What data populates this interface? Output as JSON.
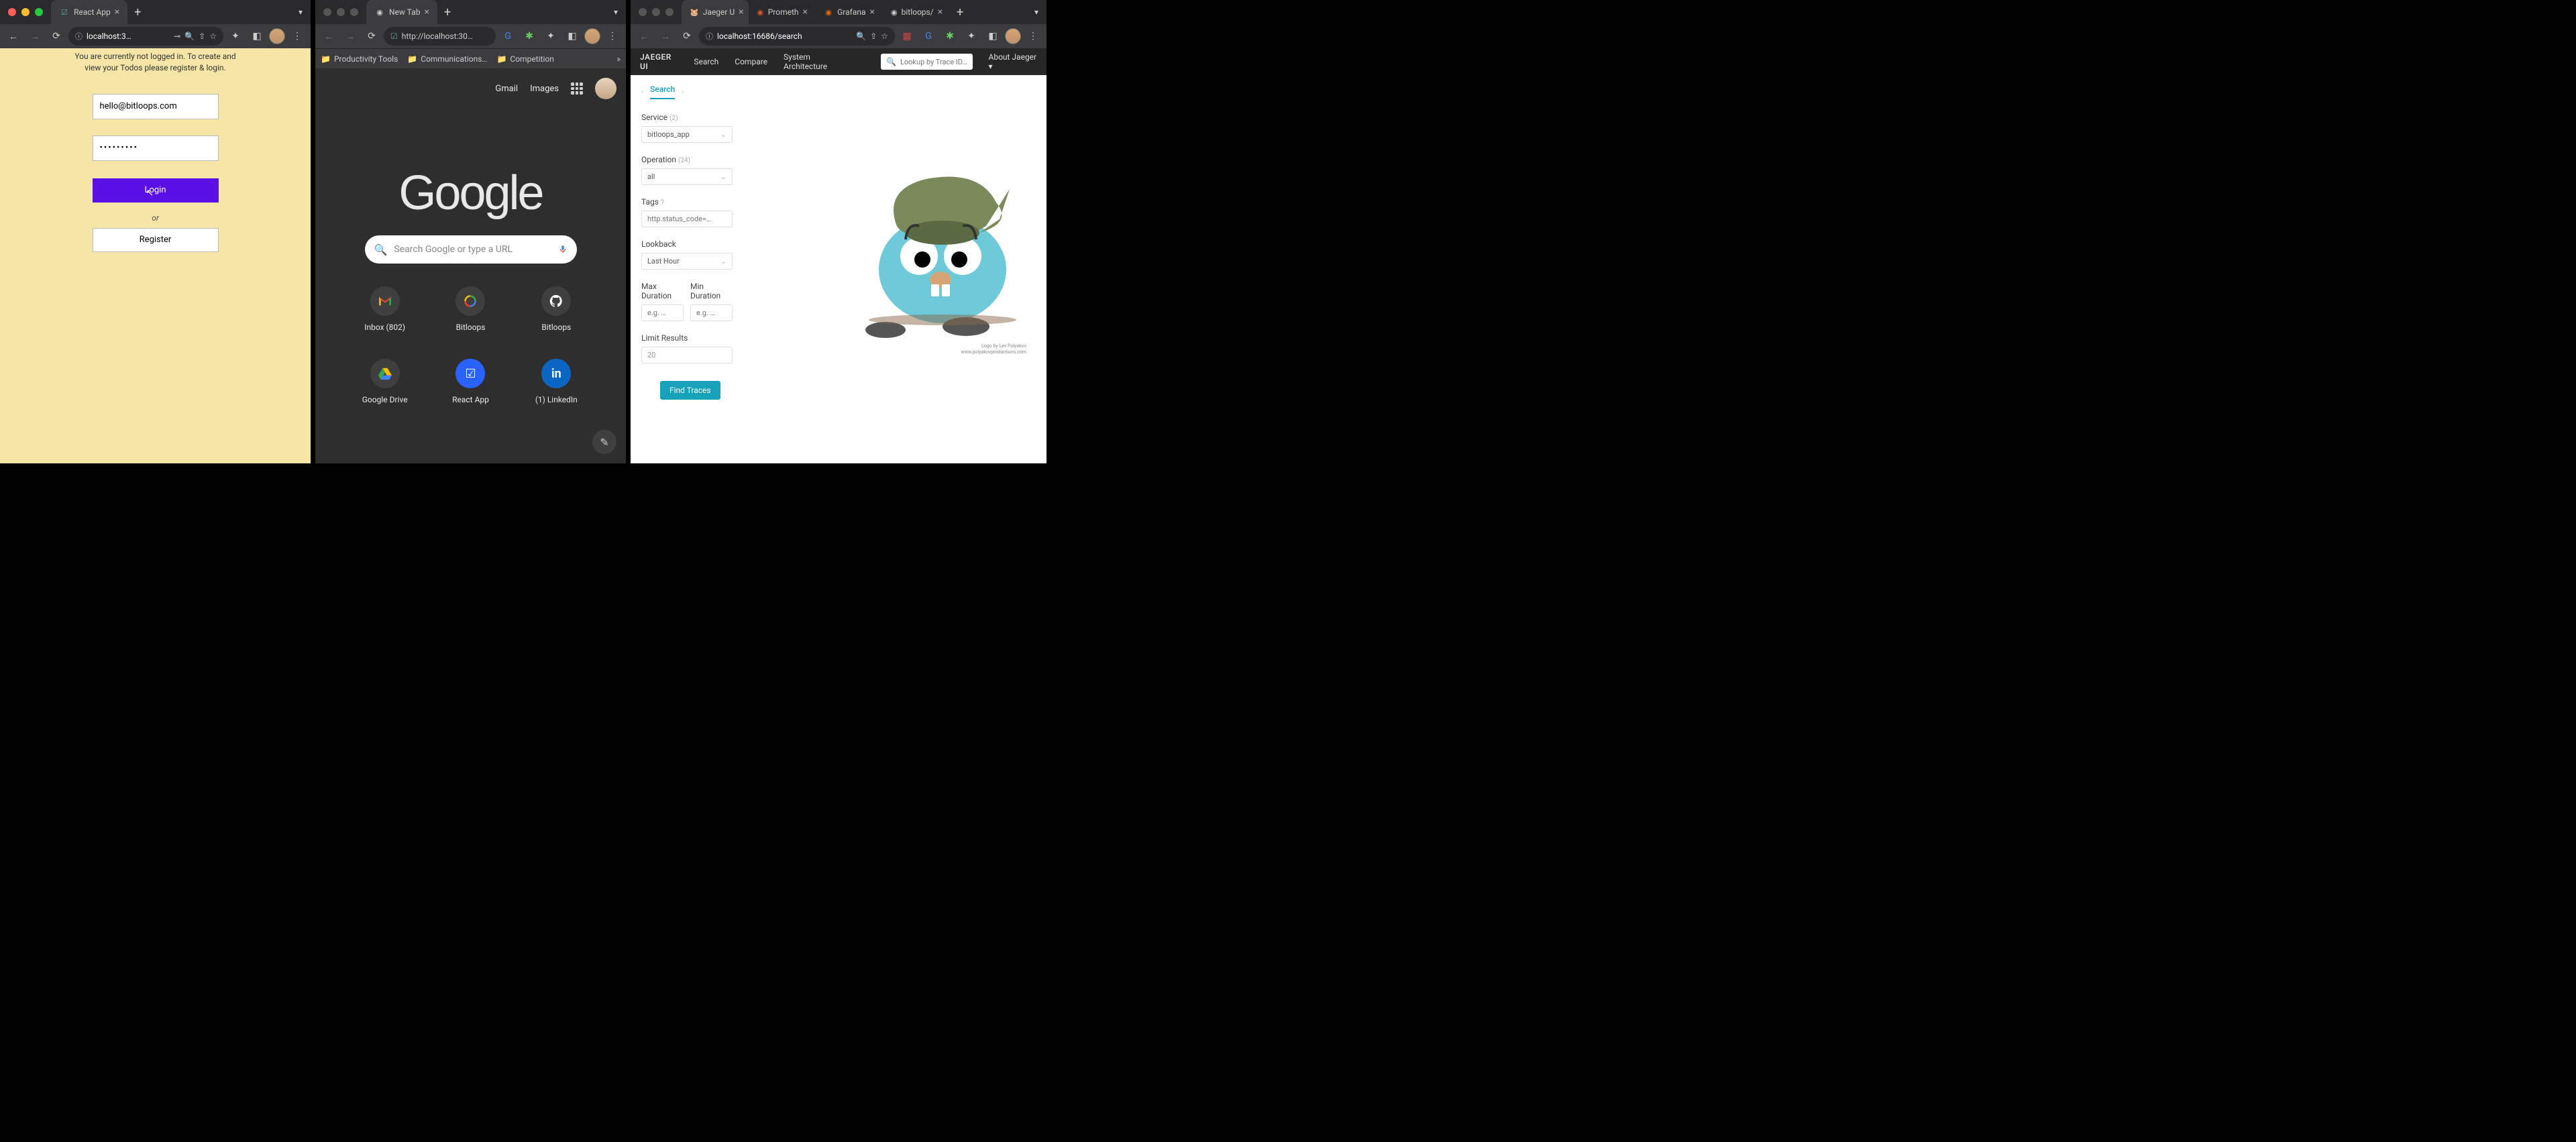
{
  "w1": {
    "tab_title": "React App",
    "url": "localhost:3…",
    "msg": "You are currently not logged in. To create and view your Todos please register & login.",
    "email": "hello@bitloops.com",
    "password": "•••••••••",
    "login_label": "Login",
    "or_label": "or",
    "register_label": "Register"
  },
  "w2": {
    "tab_title": "New Tab",
    "url": "http://localhost:30…",
    "bookmarks": [
      "Productivity Tools",
      "Communications…",
      "Competition"
    ],
    "gmail": "Gmail",
    "images": "Images",
    "logo": "Google",
    "search_placeholder": "Search Google or type a URL",
    "shortcuts": [
      {
        "label": "Inbox (802)"
      },
      {
        "label": "Bitloops"
      },
      {
        "label": "Bitloops"
      },
      {
        "label": "Google Drive"
      },
      {
        "label": "React App"
      },
      {
        "label": "(1) LinkedIn"
      }
    ]
  },
  "w3": {
    "tabs": [
      "Jaeger U",
      "Prometh",
      "Grafana",
      "bitloops/"
    ],
    "url": "localhost:16686/search",
    "brand": "JAEGER UI",
    "nav": [
      "Search",
      "Compare",
      "System Architecture"
    ],
    "trace_placeholder": "Lookup by Trace ID…",
    "about": "About Jaeger",
    "search_tab": "Search",
    "service_label": "Service",
    "service_count": "(2)",
    "service_value": "bitloops_app",
    "operation_label": "Operation",
    "operation_count": "(24)",
    "operation_value": "all",
    "tags_label": "Tags",
    "tags_placeholder": "http.status_code=…",
    "lookback_label": "Lookback",
    "lookback_value": "Last Hour",
    "max_label": "Max Duration",
    "min_label": "Min Duration",
    "dur_placeholder": "e.g. …",
    "limit_label": "Limit Results",
    "limit_value": "20",
    "find_label": "Find Traces",
    "credit1": "Logo by Lev Polyakov",
    "credit2": "www.polyakovproductions.com"
  }
}
